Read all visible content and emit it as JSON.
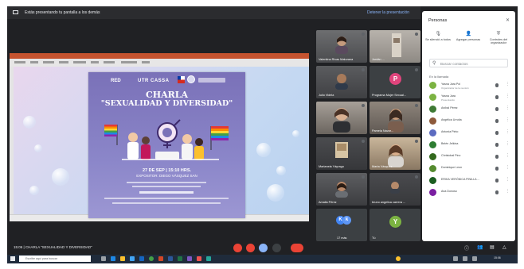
{
  "presentation_bar": {
    "text": "Estás presentando tu pantalla a los demás",
    "stop_label": "Detener la presentación"
  },
  "poster": {
    "logo_left": "RED",
    "logo_mid": "UTR CASSA",
    "title_line1": "CHARLA",
    "title_line2": "\"SEXUALIDAD Y DIVERSIDAD\"",
    "date_line": "27 DE SEP | 15:10 HRS.",
    "venue_line": "EXPOSITOR: DIEGO VÁSQUEZ SAN"
  },
  "tiles": [
    {
      "name": "Valentina Rivas Maturana",
      "type": "video"
    },
    {
      "name": "Jordán ...",
      "type": "video"
    },
    {
      "name": "Julio Videla",
      "type": "video"
    },
    {
      "name": "Programa Mujer Sexual...",
      "type": "avatar",
      "initial": "P",
      "color": "#e0447c"
    },
    {
      "name": "",
      "type": "video"
    },
    {
      "name": "Pamela Navar...",
      "type": "video"
    },
    {
      "name": "Marianela Yáyrago",
      "type": "video"
    },
    {
      "name": "Marta Vásquez",
      "type": "video"
    },
    {
      "name": "Amalia Pérez",
      "type": "video"
    },
    {
      "name": "bruno angelica carrera ...",
      "type": "video"
    },
    {
      "name": "17 más",
      "type": "group",
      "initial": "k",
      "color": "#4285f4"
    },
    {
      "name": "Tú",
      "type": "avatar",
      "initial": "Y",
      "color": "#7cb342"
    }
  ],
  "people_panel": {
    "title": "Personas",
    "close_icon": "close-icon",
    "actions": [
      {
        "label": "Se silenció a todos",
        "icon": "mic-off-icon"
      },
      {
        "label": "Agregar personas",
        "icon": "person-add-icon"
      },
      {
        "label": "Controles del organizador",
        "icon": "shield-icon"
      }
    ],
    "search_placeholder": "Buscar contactos",
    "section_label": "En la llamada",
    "participants": [
      {
        "name": "Yasna Jara Pol",
        "sub": "Organizador de la reunión",
        "color": "#7cb342"
      },
      {
        "name": "Yasna Jara",
        "sub": "Presentando",
        "color": "#7cb342"
      },
      {
        "name": "Aníbal Pérez",
        "sub": "",
        "color": "#3f7a35"
      },
      {
        "name": "Angélica Urrutia",
        "sub": "",
        "color": "#8d5a3b"
      },
      {
        "name": "Antonia Pinto",
        "sub": "",
        "color": "#5c6bc0"
      },
      {
        "name": "Belén Jelkina",
        "sub": "",
        "color": "#2e7d32"
      },
      {
        "name": "Christobal Pino",
        "sub": "",
        "color": "#33691e"
      },
      {
        "name": "Dominique Leon",
        "sub": "",
        "color": "#558b2f"
      },
      {
        "name": "ERIKA VERÓNICA PINILLA ...",
        "sub": "",
        "color": "#1b5e20"
      },
      {
        "name": "Ana Donoso",
        "sub": "",
        "color": "#7b1fa2"
      }
    ]
  },
  "bottom_bar": {
    "time": "15:06",
    "meeting_name": "CHARLA \"SEXUALIDAD Y DIVERSIDAD\""
  },
  "taskbar": {
    "search_text": "Escribe aquí para buscar",
    "clock": "15:06"
  },
  "colors": {
    "meet_bg": "#202124",
    "panel_bg": "#ffffff",
    "end_call": "#ea4335",
    "present_blue": "#8ab4f8",
    "poster_purple": "#7a71b8"
  }
}
